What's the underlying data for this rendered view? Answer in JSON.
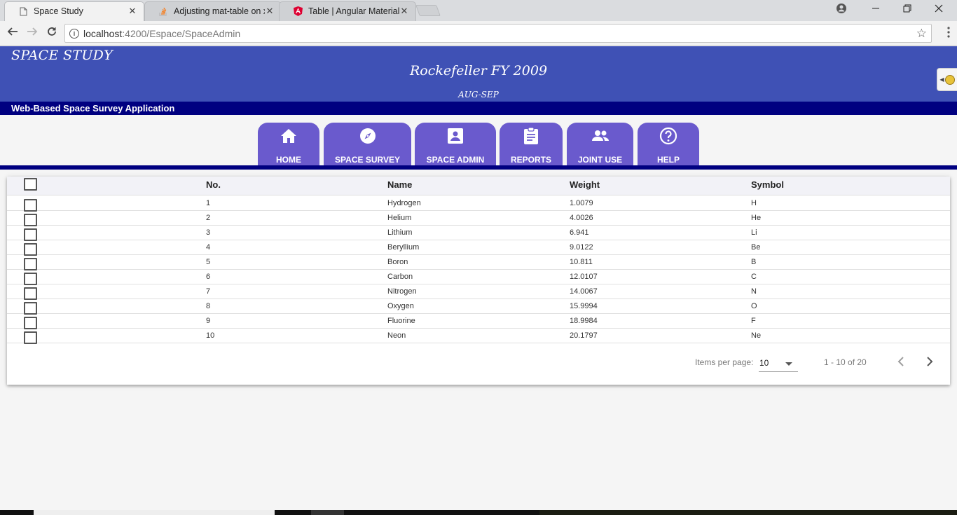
{
  "browser": {
    "tabs": [
      {
        "title": "Space Study",
        "icon": "page-icon",
        "active": true
      },
      {
        "title": "Adjusting mat-table on x",
        "icon": "stackoverflow-icon",
        "active": false
      },
      {
        "title": "Table | Angular Material",
        "icon": "angular-icon",
        "active": false
      }
    ],
    "url_host": "localhost",
    "url_path": ":4200/Espace/SpaceAdmin"
  },
  "header": {
    "app_title": "SPACE STUDY",
    "fy_title": "Rockefeller FY 2009",
    "period": "AUG-SEP",
    "subtitle": "Web-Based Space Survey Application",
    "brand_color": "#3f51b5",
    "bar_color": "#000080"
  },
  "nav": {
    "tile_color": "#6a5acd",
    "items": [
      {
        "label": "HOME",
        "icon": "home-icon"
      },
      {
        "label": "SPACE SURVEY",
        "icon": "compass-icon"
      },
      {
        "label": "SPACE ADMIN",
        "icon": "account-box-icon"
      },
      {
        "label": "REPORTS",
        "icon": "clipboard-icon"
      },
      {
        "label": "JOINT USE",
        "icon": "people-icon"
      },
      {
        "label": "HELP",
        "icon": "help-circle-icon"
      }
    ]
  },
  "table": {
    "columns": [
      "No.",
      "Name",
      "Weight",
      "Symbol"
    ],
    "rows": [
      {
        "no": "1",
        "name": "Hydrogen",
        "weight": "1.0079",
        "symbol": "H"
      },
      {
        "no": "2",
        "name": "Helium",
        "weight": "4.0026",
        "symbol": "He"
      },
      {
        "no": "3",
        "name": "Lithium",
        "weight": "6.941",
        "symbol": "Li"
      },
      {
        "no": "4",
        "name": "Beryllium",
        "weight": "9.0122",
        "symbol": "Be"
      },
      {
        "no": "5",
        "name": "Boron",
        "weight": "10.811",
        "symbol": "B"
      },
      {
        "no": "6",
        "name": "Carbon",
        "weight": "12.0107",
        "symbol": "C"
      },
      {
        "no": "7",
        "name": "Nitrogen",
        "weight": "14.0067",
        "symbol": "N"
      },
      {
        "no": "8",
        "name": "Oxygen",
        "weight": "15.9994",
        "symbol": "O"
      },
      {
        "no": "9",
        "name": "Fluorine",
        "weight": "18.9984",
        "symbol": "F"
      },
      {
        "no": "10",
        "name": "Neon",
        "weight": "20.1797",
        "symbol": "Ne"
      }
    ]
  },
  "paginator": {
    "items_per_page_label": "Items per page:",
    "page_size": "10",
    "range_label": "1 - 10 of 20"
  }
}
